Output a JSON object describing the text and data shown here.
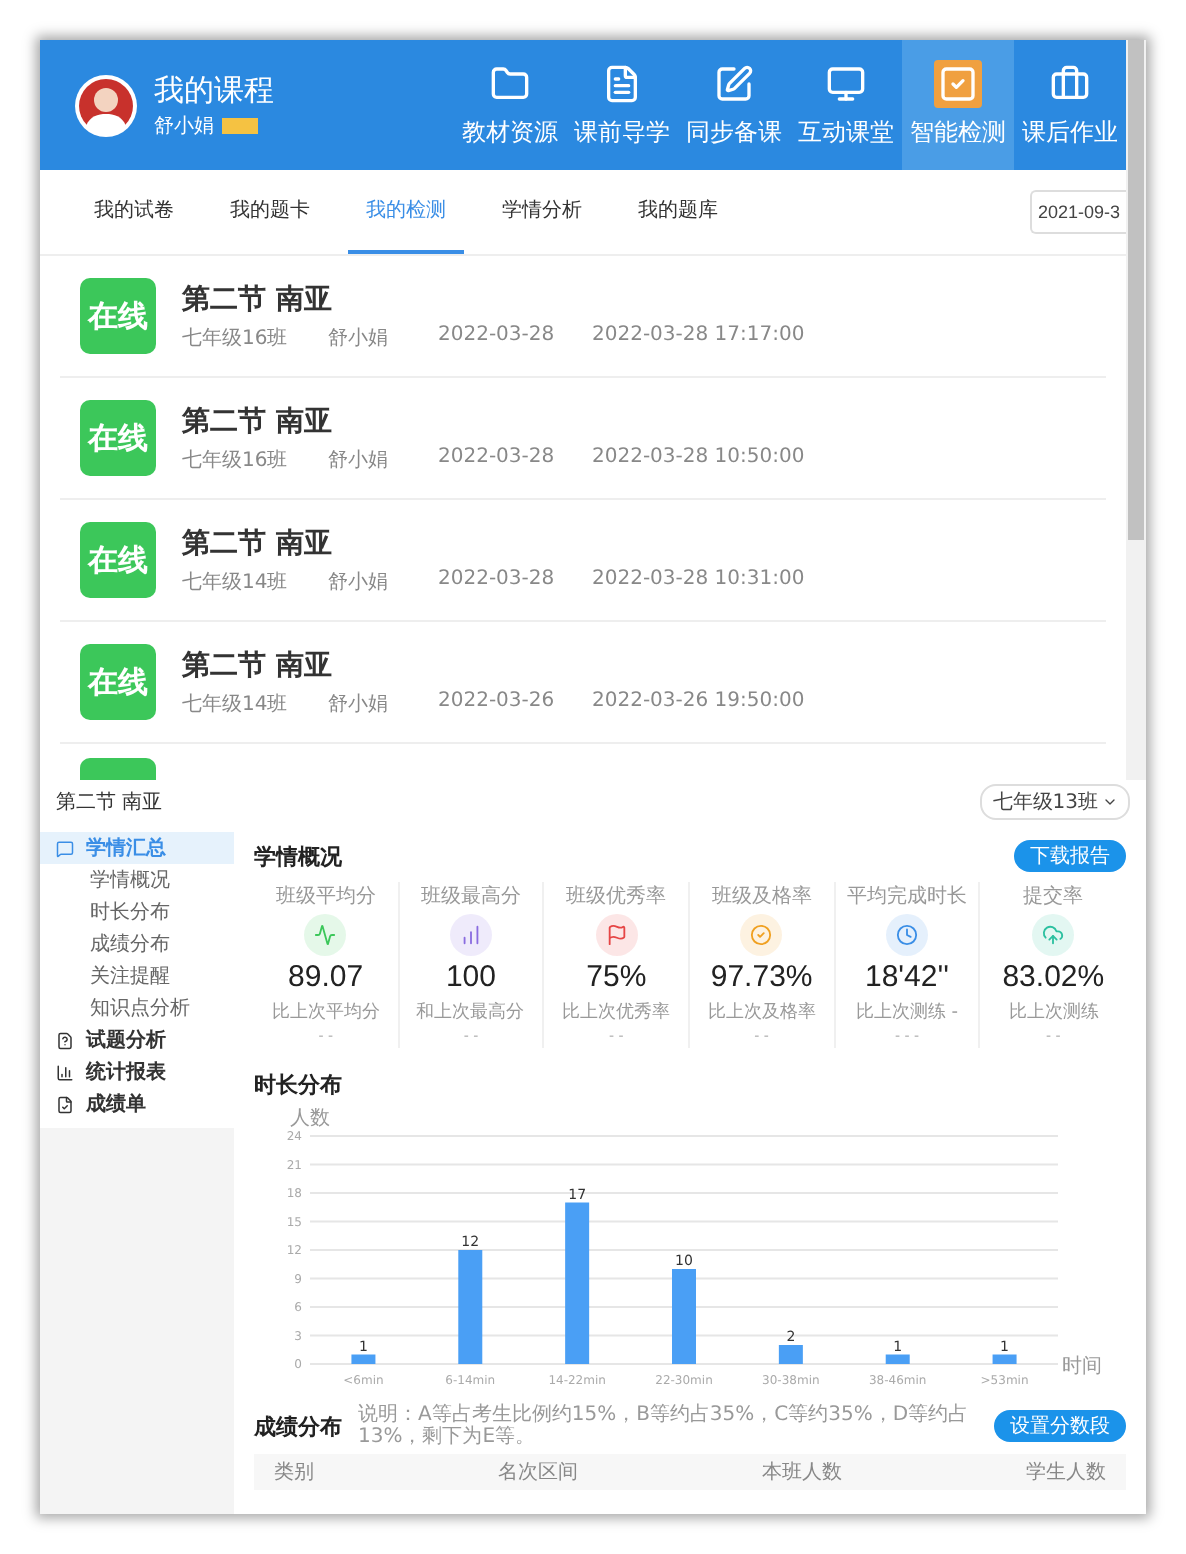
{
  "header": {
    "title": "我的课程",
    "user": "舒小娟",
    "nav": [
      {
        "label": "教材资源",
        "selected": false
      },
      {
        "label": "课前导学",
        "selected": false
      },
      {
        "label": "同步备课",
        "selected": false
      },
      {
        "label": "互动课堂",
        "selected": false
      },
      {
        "label": "智能检测",
        "selected": true
      },
      {
        "label": "课后作业",
        "selected": false
      }
    ]
  },
  "tabs": [
    {
      "label": "我的试卷",
      "selected": false
    },
    {
      "label": "我的题卡",
      "selected": false
    },
    {
      "label": "我的检测",
      "selected": true
    },
    {
      "label": "学情分析",
      "selected": false
    },
    {
      "label": "我的题库",
      "selected": false
    }
  ],
  "date_field": {
    "value": "2021-09-3"
  },
  "records": [
    {
      "badge": "在线",
      "title": "第二节 南亚",
      "class": "七年级16班",
      "teacher": "舒小娟",
      "date": "2022-03-28",
      "time": "2022-03-28 17:17:00"
    },
    {
      "badge": "在线",
      "title": "第二节 南亚",
      "class": "七年级16班",
      "teacher": "舒小娟",
      "date": "2022-03-28",
      "time": "2022-03-28 10:50:00"
    },
    {
      "badge": "在线",
      "title": "第二节 南亚",
      "class": "七年级14班",
      "teacher": "舒小娟",
      "date": "2022-03-28",
      "time": "2022-03-28 10:31:00"
    },
    {
      "badge": "在线",
      "title": "第二节 南亚",
      "class": "七年级14班",
      "teacher": "舒小娟",
      "date": "2022-03-26",
      "time": "2022-03-26 19:50:00"
    }
  ],
  "report": {
    "title": "第二节 南亚",
    "class_select": "七年级13班",
    "sidebar": [
      {
        "label": "学情汇总",
        "selected": true,
        "children": [
          {
            "label": "学情概况",
            "selected": false
          },
          {
            "label": "时长分布",
            "selected": false
          },
          {
            "label": "成绩分布",
            "selected": false
          },
          {
            "label": "关注提醒",
            "selected": false
          },
          {
            "label": "知识点分析",
            "selected": false
          }
        ]
      },
      {
        "label": "试题分析",
        "selected": false
      },
      {
        "label": "统计报表",
        "selected": false
      },
      {
        "label": "成绩单",
        "selected": false
      }
    ],
    "overview": {
      "title": "学情概况",
      "button": "下载报告",
      "stats": [
        {
          "label": "班级平均分",
          "value": "89.07",
          "compare": "比上次平均分",
          "delta": "- -",
          "color": "#3cc75a"
        },
        {
          "label": "班级最高分",
          "value": "100",
          "compare": "和上次最高分",
          "delta": "- -",
          "color": "#8a6ce0"
        },
        {
          "label": "班级优秀率",
          "value": "75%",
          "compare": "比上次优秀率",
          "delta": "- -",
          "color": "#e64545"
        },
        {
          "label": "班级及格率",
          "value": "97.73%",
          "compare": "比上次及格率",
          "delta": "- -",
          "color": "#f0a020"
        },
        {
          "label": "平均完成时长",
          "value": "18'42''",
          "compare": "比上次测练 -",
          "delta": "- - -",
          "color": "#3a8ee6"
        },
        {
          "label": "提交率",
          "value": "83.02%",
          "compare": "比上次测练",
          "delta": "- -",
          "color": "#2cc0a0"
        }
      ]
    },
    "duration": {
      "title": "时长分布",
      "chart_data": {
        "type": "bar",
        "xlabel": "时间",
        "ylabel": "人数",
        "categories": [
          "<6min",
          "6-14min",
          "14-22min",
          "22-30min",
          "30-38min",
          "38-46min",
          ">53min"
        ],
        "series": [
          {
            "color": "#4a9ff5",
            "values": [
              1,
              12,
              17,
              10,
              2,
              1,
              1
            ]
          }
        ],
        "grid": true,
        "ylim": [
          0,
          24
        ],
        "yticks": [
          0,
          3,
          6,
          9,
          12,
          15,
          18,
          21,
          24
        ],
        "data_labels": true
      }
    },
    "scores": {
      "title": "成绩分布",
      "note": "说明：A等占考生比例约15%，B等约占35%，C等约35%，D等约占13%，剩下为E等。",
      "button": "设置分数段",
      "columns": [
        "类别",
        "名次区间",
        "本班人数",
        "学生人数"
      ]
    }
  }
}
